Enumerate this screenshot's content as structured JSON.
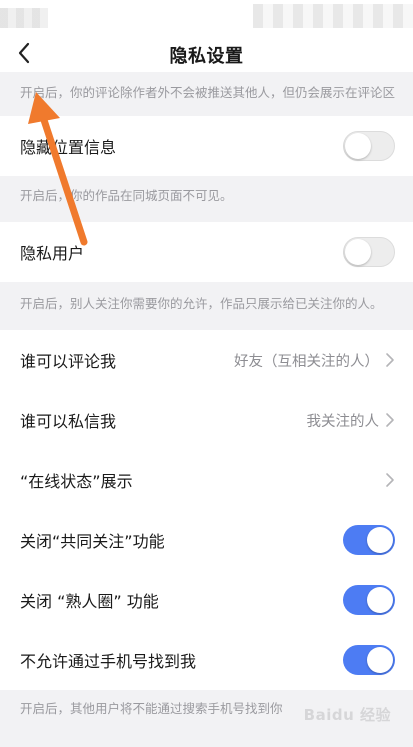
{
  "header": {
    "title": "隐私设置"
  },
  "descriptions": {
    "comment_desc": "开启后，你的评论除作者外不会被推送其他人，但仍会展示在评论区",
    "location_desc": "开启后，你的作品在同城页面不可见。",
    "private_desc": "开启后，别人关注你需要你的允许，作品只展示给已关注你的人。",
    "phone_desc": "开启后，其他用户将不能通过搜索手机号找到你"
  },
  "rows": {
    "hide_location": {
      "label": "隐藏位置信息",
      "toggle": "off"
    },
    "private_user": {
      "label": "隐私用户",
      "toggle": "off"
    },
    "who_comment": {
      "label": "谁可以评论我",
      "value": "好友（互相关注的人）"
    },
    "who_message": {
      "label": "谁可以私信我",
      "value": "我关注的人"
    },
    "online_status": {
      "label": "“在线状态”展示"
    },
    "close_mutual_follow": {
      "label": "关闭“共同关注”功能",
      "toggle": "on"
    },
    "close_acquaintance": {
      "label": "关闭 “熟人圈” 功能",
      "toggle": "on"
    },
    "phone_search": {
      "label": "不允许通过手机号找到我",
      "toggle": "on"
    }
  },
  "watermark": "Baidu 经验",
  "colors": {
    "accent": "#4d7cf3",
    "annotation_arrow": "#f07a2d",
    "background": "#f2f2f4"
  }
}
